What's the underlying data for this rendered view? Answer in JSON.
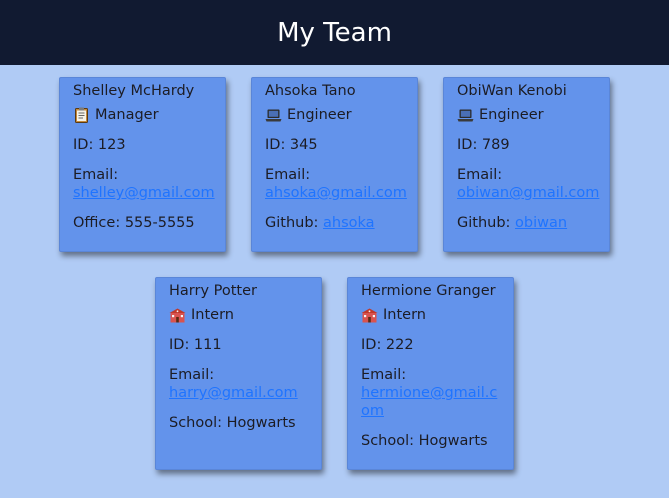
{
  "header": {
    "title": "My Team"
  },
  "employees": [
    {
      "name": "Shelley McHardy",
      "role": "Manager",
      "role_icon": "clipboard-icon",
      "id_label": "ID: 123",
      "email_label": "Email:",
      "email": "shelley@gmail.com",
      "extra_label": "Office: 555-5555"
    },
    {
      "name": "Ahsoka Tano",
      "role": "Engineer",
      "role_icon": "laptop-icon",
      "id_label": "ID: 345",
      "email_label": "Email:",
      "email": "ahsoka@gmail.com",
      "extra_label": "Github:",
      "extra_link": "ahsoka"
    },
    {
      "name": "ObiWan Kenobi",
      "role": "Engineer",
      "role_icon": "laptop-icon",
      "id_label": "ID: 789",
      "email_label": "Email:",
      "email": "obiwan@gmail.com",
      "extra_label": "Github:",
      "extra_link": "obiwan"
    },
    {
      "name": "Harry Potter",
      "role": "Intern",
      "role_icon": "school-icon",
      "id_label": "ID: 111",
      "email_label": "Email:",
      "email": "harry@gmail.com",
      "extra_label": "School: Hogwarts"
    },
    {
      "name": "Hermione Granger",
      "role": "Intern",
      "role_icon": "school-icon",
      "id_label": "ID: 222",
      "email_label": "Email:",
      "email": "hermione@gmail.com",
      "extra_label": "School: Hogwarts"
    }
  ],
  "colors": {
    "header_bg": "#111a31",
    "page_bg": "#b0cbf5",
    "card_bg": "#6393eb",
    "link": "#1f74ff"
  }
}
